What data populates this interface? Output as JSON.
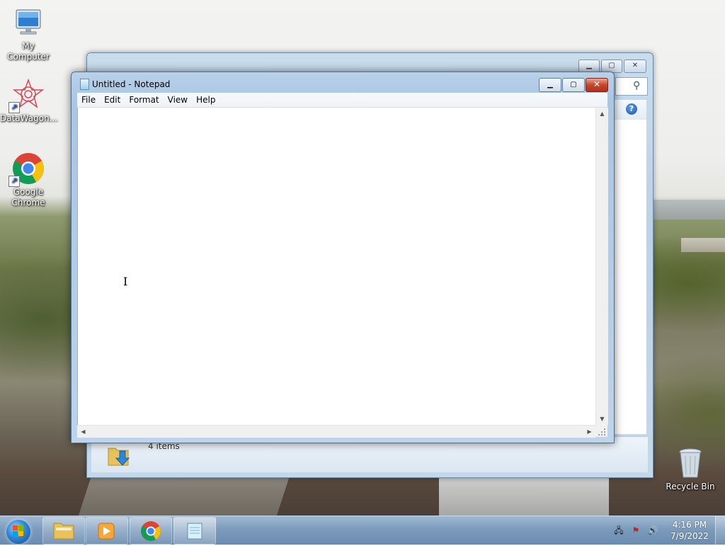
{
  "desktop": {
    "icons": [
      {
        "label": "My Computer",
        "icon": "my-computer-icon"
      },
      {
        "label": "DataWagon...",
        "icon": "datawagon-icon"
      },
      {
        "label": "Google Chrome",
        "icon": "chrome-icon"
      },
      {
        "label": "Recycle Bin",
        "icon": "recycle-bin-icon"
      }
    ]
  },
  "explorer": {
    "status_count": "4 items"
  },
  "notepad": {
    "title": "Untitled - Notepad",
    "menu": [
      "File",
      "Edit",
      "Format",
      "View",
      "Help"
    ],
    "content": ""
  },
  "taskbar": {
    "buttons": [
      "windows-explorer",
      "windows-media-player",
      "google-chrome",
      "notepad"
    ],
    "clock_time": "4:16 PM",
    "clock_date": "7/9/2022"
  },
  "colors": {
    "close_button": "#c7452c",
    "taskbar": "#7c9bbc",
    "title_active": "#a9c6e4"
  }
}
